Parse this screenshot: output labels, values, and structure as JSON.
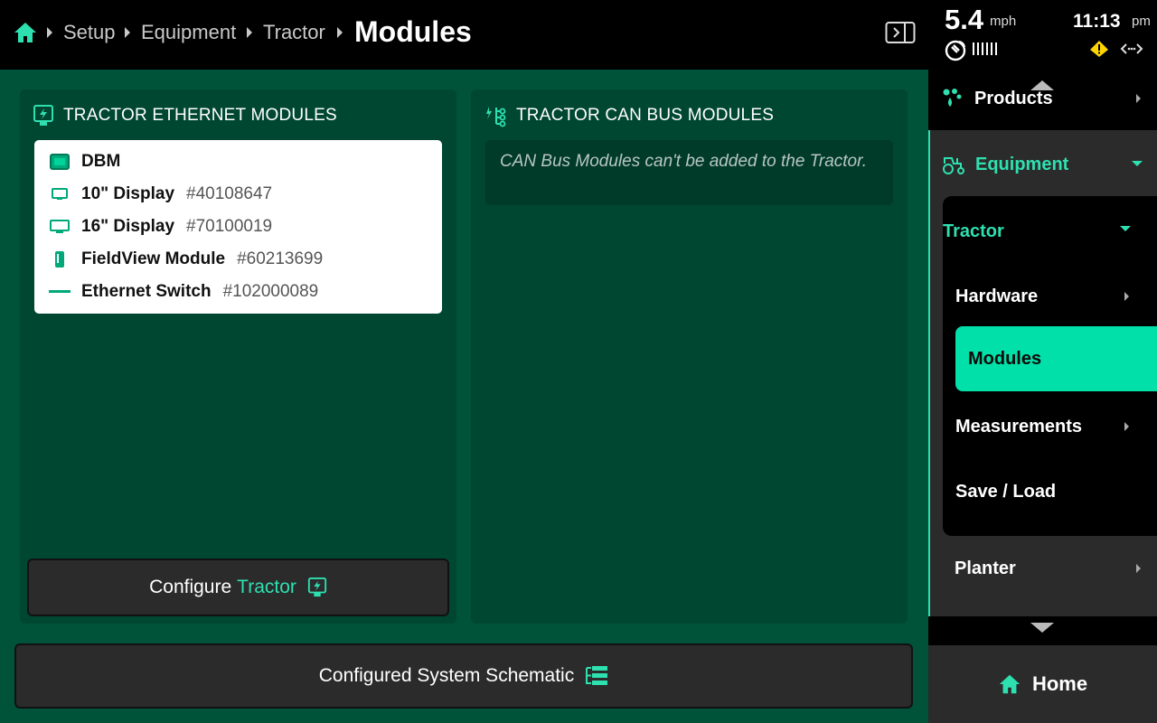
{
  "breadcrumb": {
    "items": [
      "Setup",
      "Equipment",
      "Tractor"
    ],
    "current": "Modules"
  },
  "status": {
    "speed": "5.4",
    "speed_unit": "mph",
    "time": "11:13",
    "ampm": "pm"
  },
  "ethernet_card": {
    "title": "TRACTOR ETHERNET MODULES",
    "modules": [
      {
        "name": "DBM",
        "serial": "",
        "icon": "dbm-icon"
      },
      {
        "name": "10\" Display",
        "serial": "#40108647",
        "icon": "display-icon"
      },
      {
        "name": "16\" Display",
        "serial": "#70100019",
        "icon": "display-icon"
      },
      {
        "name": "FieldView Module",
        "serial": "#60213699",
        "icon": "fieldview-icon"
      },
      {
        "name": "Ethernet Switch",
        "serial": "#102000089",
        "icon": "switch-icon"
      }
    ],
    "configure_label": "Configure",
    "configure_accent": "Tractor"
  },
  "can_card": {
    "title": "TRACTOR CAN BUS MODULES",
    "note": "CAN Bus Modules can't be added to the Tractor."
  },
  "schematic_label": "Configured System Schematic",
  "nav": {
    "products": "Products",
    "equipment": "Equipment",
    "tractor": "Tractor",
    "hardware": "Hardware",
    "modules": "Modules",
    "measurements": "Measurements",
    "save_load": "Save / Load",
    "planter": "Planter",
    "home": "Home"
  },
  "colors": {
    "accent": "#2ee0b0",
    "active": "#00e0a8",
    "background": "#005239",
    "card": "#004732"
  }
}
